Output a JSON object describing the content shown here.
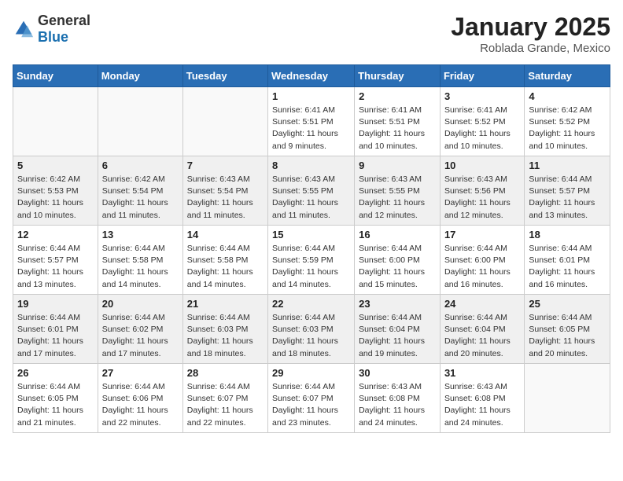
{
  "header": {
    "logo_general": "General",
    "logo_blue": "Blue",
    "month_title": "January 2025",
    "location": "Roblada Grande, Mexico"
  },
  "days_of_week": [
    "Sunday",
    "Monday",
    "Tuesday",
    "Wednesday",
    "Thursday",
    "Friday",
    "Saturday"
  ],
  "weeks": [
    [
      {
        "day": "",
        "info": ""
      },
      {
        "day": "",
        "info": ""
      },
      {
        "day": "",
        "info": ""
      },
      {
        "day": "1",
        "info": "Sunrise: 6:41 AM\nSunset: 5:51 PM\nDaylight: 11 hours and 9 minutes."
      },
      {
        "day": "2",
        "info": "Sunrise: 6:41 AM\nSunset: 5:51 PM\nDaylight: 11 hours and 10 minutes."
      },
      {
        "day": "3",
        "info": "Sunrise: 6:41 AM\nSunset: 5:52 PM\nDaylight: 11 hours and 10 minutes."
      },
      {
        "day": "4",
        "info": "Sunrise: 6:42 AM\nSunset: 5:52 PM\nDaylight: 11 hours and 10 minutes."
      }
    ],
    [
      {
        "day": "5",
        "info": "Sunrise: 6:42 AM\nSunset: 5:53 PM\nDaylight: 11 hours and 10 minutes."
      },
      {
        "day": "6",
        "info": "Sunrise: 6:42 AM\nSunset: 5:54 PM\nDaylight: 11 hours and 11 minutes."
      },
      {
        "day": "7",
        "info": "Sunrise: 6:43 AM\nSunset: 5:54 PM\nDaylight: 11 hours and 11 minutes."
      },
      {
        "day": "8",
        "info": "Sunrise: 6:43 AM\nSunset: 5:55 PM\nDaylight: 11 hours and 11 minutes."
      },
      {
        "day": "9",
        "info": "Sunrise: 6:43 AM\nSunset: 5:55 PM\nDaylight: 11 hours and 12 minutes."
      },
      {
        "day": "10",
        "info": "Sunrise: 6:43 AM\nSunset: 5:56 PM\nDaylight: 11 hours and 12 minutes."
      },
      {
        "day": "11",
        "info": "Sunrise: 6:44 AM\nSunset: 5:57 PM\nDaylight: 11 hours and 13 minutes."
      }
    ],
    [
      {
        "day": "12",
        "info": "Sunrise: 6:44 AM\nSunset: 5:57 PM\nDaylight: 11 hours and 13 minutes."
      },
      {
        "day": "13",
        "info": "Sunrise: 6:44 AM\nSunset: 5:58 PM\nDaylight: 11 hours and 14 minutes."
      },
      {
        "day": "14",
        "info": "Sunrise: 6:44 AM\nSunset: 5:58 PM\nDaylight: 11 hours and 14 minutes."
      },
      {
        "day": "15",
        "info": "Sunrise: 6:44 AM\nSunset: 5:59 PM\nDaylight: 11 hours and 14 minutes."
      },
      {
        "day": "16",
        "info": "Sunrise: 6:44 AM\nSunset: 6:00 PM\nDaylight: 11 hours and 15 minutes."
      },
      {
        "day": "17",
        "info": "Sunrise: 6:44 AM\nSunset: 6:00 PM\nDaylight: 11 hours and 16 minutes."
      },
      {
        "day": "18",
        "info": "Sunrise: 6:44 AM\nSunset: 6:01 PM\nDaylight: 11 hours and 16 minutes."
      }
    ],
    [
      {
        "day": "19",
        "info": "Sunrise: 6:44 AM\nSunset: 6:01 PM\nDaylight: 11 hours and 17 minutes."
      },
      {
        "day": "20",
        "info": "Sunrise: 6:44 AM\nSunset: 6:02 PM\nDaylight: 11 hours and 17 minutes."
      },
      {
        "day": "21",
        "info": "Sunrise: 6:44 AM\nSunset: 6:03 PM\nDaylight: 11 hours and 18 minutes."
      },
      {
        "day": "22",
        "info": "Sunrise: 6:44 AM\nSunset: 6:03 PM\nDaylight: 11 hours and 18 minutes."
      },
      {
        "day": "23",
        "info": "Sunrise: 6:44 AM\nSunset: 6:04 PM\nDaylight: 11 hours and 19 minutes."
      },
      {
        "day": "24",
        "info": "Sunrise: 6:44 AM\nSunset: 6:04 PM\nDaylight: 11 hours and 20 minutes."
      },
      {
        "day": "25",
        "info": "Sunrise: 6:44 AM\nSunset: 6:05 PM\nDaylight: 11 hours and 20 minutes."
      }
    ],
    [
      {
        "day": "26",
        "info": "Sunrise: 6:44 AM\nSunset: 6:05 PM\nDaylight: 11 hours and 21 minutes."
      },
      {
        "day": "27",
        "info": "Sunrise: 6:44 AM\nSunset: 6:06 PM\nDaylight: 11 hours and 22 minutes."
      },
      {
        "day": "28",
        "info": "Sunrise: 6:44 AM\nSunset: 6:07 PM\nDaylight: 11 hours and 22 minutes."
      },
      {
        "day": "29",
        "info": "Sunrise: 6:44 AM\nSunset: 6:07 PM\nDaylight: 11 hours and 23 minutes."
      },
      {
        "day": "30",
        "info": "Sunrise: 6:43 AM\nSunset: 6:08 PM\nDaylight: 11 hours and 24 minutes."
      },
      {
        "day": "31",
        "info": "Sunrise: 6:43 AM\nSunset: 6:08 PM\nDaylight: 11 hours and 24 minutes."
      },
      {
        "day": "",
        "info": ""
      }
    ]
  ]
}
